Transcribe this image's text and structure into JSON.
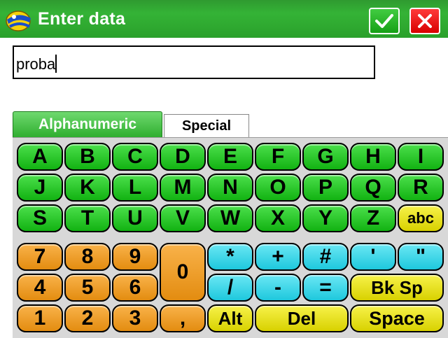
{
  "window": {
    "title": "Enter data"
  },
  "buttons": {
    "ok_icon": "checkmark-icon",
    "cancel_icon": "close-icon"
  },
  "input": {
    "value": "proba"
  },
  "tabs": [
    {
      "label": "Alphanumeric",
      "active": true
    },
    {
      "label": "Special",
      "active": false
    }
  ],
  "keyboard": {
    "row1": [
      "A",
      "B",
      "C",
      "D",
      "E",
      "F",
      "G",
      "H",
      "I"
    ],
    "row2": [
      "J",
      "K",
      "L",
      "M",
      "N",
      "O",
      "P",
      "Q",
      "R"
    ],
    "row3": [
      "S",
      "T",
      "U",
      "V",
      "W",
      "X",
      "Y",
      "Z"
    ],
    "abc": "abc",
    "num_row1": [
      "7",
      "8",
      "9"
    ],
    "num_row2": [
      "4",
      "5",
      "6"
    ],
    "num_row3": [
      "1",
      "2",
      "3"
    ],
    "zero": "0",
    "comma": ",",
    "symbols_row1": [
      "*",
      "+",
      "#",
      "'",
      "\""
    ],
    "symbols_row2": [
      "/",
      "-",
      "="
    ],
    "alt": "Alt",
    "del": "Del",
    "bksp": "Bk Sp",
    "space": "Space"
  },
  "colors": {
    "title_bar": "#2aa02b",
    "letter_keys": "#22c422",
    "number_keys": "#f0a030",
    "symbol_keys": "#3fd8ea",
    "function_keys": "#f0ea20",
    "cancel": "#e00000"
  }
}
